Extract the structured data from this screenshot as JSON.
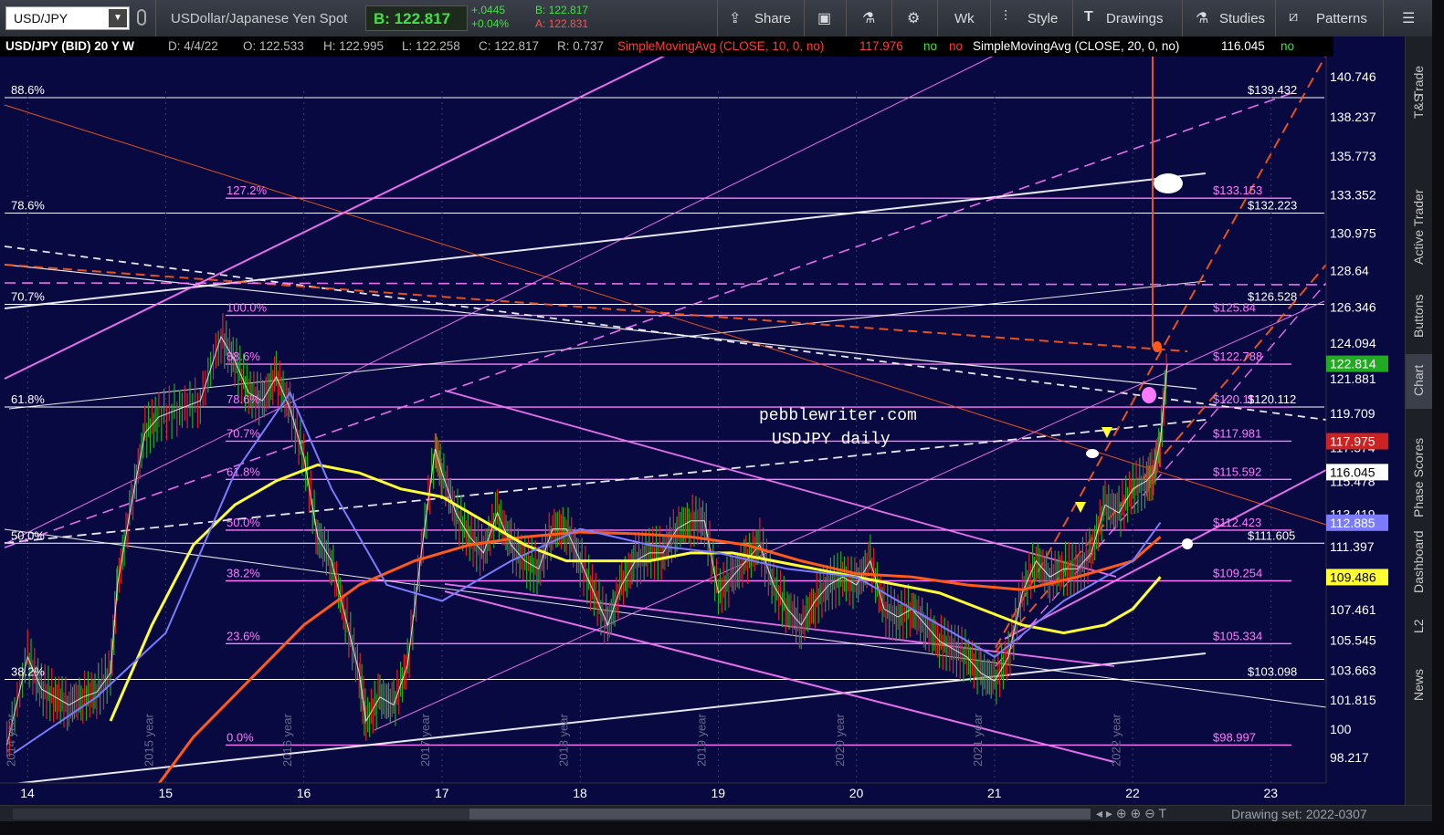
{
  "toolbar": {
    "symbol": "USD/JPY",
    "description": "USDollar/Japanese Yen Spot",
    "bid_price": "B: 122.817",
    "change": "+.0445",
    "change_pct": "+0.04%",
    "bid_small": "B: 122.817",
    "ask_small": "A: 122.831",
    "share": "Share",
    "period": "Wk",
    "style": "Style",
    "drawings": "Drawings",
    "studies": "Studies",
    "patterns": "Patterns"
  },
  "infobar": {
    "title": "USD/JPY (BID) 20 Y W",
    "date": "D: 4/4/22",
    "open": "O: 122.533",
    "high": "H: 122.995",
    "low": "L: 122.258",
    "close": "C: 122.817",
    "range": "R: 0.737",
    "sma10": "SimpleMovingAvg (CLOSE, 10, 0, no)",
    "sma10_val": "117.976",
    "sma10_no1": "no",
    "sma10_no2": "no",
    "sma20": "SimpleMovingAvg (CLOSE, 20, 0, no)",
    "sma20_val": "116.045",
    "sma20_no": "no"
  },
  "sidebar": {
    "tabs": [
      "Trade",
      "T&S",
      "Active Trader",
      "Buttons",
      "Chart",
      "Phase Scores",
      "Dashboard",
      "L2",
      "News"
    ]
  },
  "bottom": {
    "drawing_set": "Drawing set: 2022-0307"
  },
  "colors": {
    "background": "#090941",
    "fib_pink": "#ff7aff",
    "white": "#ffffff",
    "orange": "#ff5a1a",
    "yellow": "#ffff33",
    "blue": "#7b7bff",
    "green_candle": "#22aa22",
    "red_candle": "#dd2222"
  },
  "chart_data": {
    "type": "line",
    "title": "USD/JPY (BID) 20 Y W",
    "annotation": [
      "pebblewriter.com",
      "USDJPY daily"
    ],
    "x_ticks": [
      "14",
      "15",
      "16",
      "17",
      "18",
      "19",
      "20",
      "21",
      "22",
      "23"
    ],
    "year_labels": [
      "2014 year",
      "2015 year",
      "2016 year",
      "2017 year",
      "2018 year",
      "2019 year",
      "2020 year",
      "2021 year",
      "2022 year"
    ],
    "y_ticks": [
      140.746,
      138.237,
      135.773,
      133.352,
      130.975,
      128.64,
      126.346,
      124.094,
      121.881,
      119.709,
      117.574,
      115.478,
      113.419,
      111.397,
      109.411,
      107.461,
      105.545,
      103.663,
      101.815,
      100,
      98.217
    ],
    "ylim": [
      96.8,
      142.0
    ],
    "xlim": [
      2013.8,
      2023.4
    ],
    "last_price": 122.814,
    "price_flags": [
      {
        "label": "122.814",
        "value": 122.814,
        "color": "#22aa22"
      },
      {
        "label": "117.975",
        "value": 117.975,
        "color": "#cc2222"
      },
      {
        "label": "116.045",
        "value": 116.045,
        "color": "#ffffff"
      },
      {
        "label": "112.885",
        "value": 112.885,
        "color": "#7b7bff"
      },
      {
        "label": "109.486",
        "value": 109.486,
        "color": "#ffff33"
      }
    ],
    "right_levels": [
      {
        "label": "$139.432",
        "value": 139.432,
        "color": "#ffffff"
      },
      {
        "label": "$133.153",
        "value": 133.153,
        "color": "#ff7aff"
      },
      {
        "label": "$132.223",
        "value": 132.223,
        "color": "#ffffff"
      },
      {
        "label": "$126.528",
        "value": 126.528,
        "color": "#ffffff"
      },
      {
        "label": "$125.84",
        "value": 125.84,
        "color": "#ff7aff"
      },
      {
        "label": "$122.788",
        "value": 122.788,
        "color": "#ff7aff"
      },
      {
        "label": "$120.11",
        "value": 120.11,
        "color": "#ff7aff"
      },
      {
        "label": "$120.112",
        "value": 120.112,
        "color": "#ffffff"
      },
      {
        "label": "$117.981",
        "value": 117.981,
        "color": "#ff7aff"
      },
      {
        "label": "$115.592",
        "value": 115.592,
        "color": "#ff7aff"
      },
      {
        "label": "$112.423",
        "value": 112.423,
        "color": "#ff7aff"
      },
      {
        "label": "$111.605",
        "value": 111.605,
        "color": "#ffffff"
      },
      {
        "label": "$109.254",
        "value": 109.254,
        "color": "#ff7aff"
      },
      {
        "label": "$105.334",
        "value": 105.334,
        "color": "#ff7aff"
      },
      {
        "label": "$103.098",
        "value": 103.098,
        "color": "#ffffff"
      },
      {
        "label": "$98.997",
        "value": 98.997,
        "color": "#ff7aff"
      }
    ],
    "fib_left_white": [
      {
        "label": "88.6%",
        "value": 139.432
      },
      {
        "label": "78.6%",
        "value": 132.223
      },
      {
        "label": "70.7%",
        "value": 126.528
      },
      {
        "label": "61.8%",
        "value": 120.112
      },
      {
        "label": "50.0%",
        "value": 111.605
      },
      {
        "label": "38.2%",
        "value": 103.098
      }
    ],
    "fib_left_pink": [
      {
        "label": "127.2%",
        "value": 133.153
      },
      {
        "label": "100.0%",
        "value": 125.84
      },
      {
        "label": "88.6%",
        "value": 122.788
      },
      {
        "label": "78.6%",
        "value": 120.11
      },
      {
        "label": "70.7%",
        "value": 117.981
      },
      {
        "label": "61.8%",
        "value": 115.592
      },
      {
        "label": "50.0%",
        "value": 112.423
      },
      {
        "label": "38.2%",
        "value": 109.254
      },
      {
        "label": "23.6%",
        "value": 105.334
      },
      {
        "label": "0.0%",
        "value": 98.997
      }
    ],
    "series": [
      {
        "name": "USD/JPY",
        "color": "#ffffff",
        "x": [
          2013.85,
          2014.0,
          2014.1,
          2014.2,
          2014.3,
          2014.4,
          2014.5,
          2014.6,
          2014.65,
          2014.75,
          2014.85,
          2014.95,
          2015.1,
          2015.25,
          2015.4,
          2015.5,
          2015.6,
          2015.7,
          2015.8,
          2015.9,
          2016.0,
          2016.1,
          2016.2,
          2016.3,
          2016.4,
          2016.45,
          2016.55,
          2016.65,
          2016.75,
          2016.85,
          2016.95,
          2017.0,
          2017.1,
          2017.2,
          2017.3,
          2017.4,
          2017.5,
          2017.6,
          2017.7,
          2017.8,
          2017.9,
          2018.0,
          2018.1,
          2018.2,
          2018.3,
          2018.4,
          2018.5,
          2018.6,
          2018.7,
          2018.8,
          2018.9,
          2019.0,
          2019.1,
          2019.2,
          2019.3,
          2019.4,
          2019.5,
          2019.6,
          2019.7,
          2019.8,
          2019.9,
          2020.0,
          2020.1,
          2020.2,
          2020.3,
          2020.4,
          2020.5,
          2020.6,
          2020.7,
          2020.8,
          2020.9,
          2021.0,
          2021.1,
          2021.2,
          2021.3,
          2021.4,
          2021.5,
          2021.6,
          2021.7,
          2021.8,
          2021.9,
          2022.0,
          2022.1,
          2022.15,
          2022.2,
          2022.25
        ],
        "values": [
          99.0,
          104.5,
          102.5,
          102.0,
          101.5,
          102.0,
          102.3,
          103.5,
          109.0,
          114.0,
          118.5,
          119.5,
          120.0,
          120.5,
          124.5,
          123.0,
          121.0,
          120.5,
          122.0,
          120.0,
          117.0,
          112.0,
          110.5,
          107.0,
          103.5,
          100.5,
          102.0,
          101.5,
          104.0,
          111.0,
          117.5,
          116.0,
          113.5,
          112.0,
          111.0,
          113.5,
          111.5,
          110.5,
          110.0,
          112.5,
          112.5,
          110.5,
          108.5,
          106.5,
          109.0,
          110.5,
          111.0,
          111.0,
          112.5,
          113.0,
          113.0,
          108.5,
          109.5,
          110.5,
          111.5,
          109.0,
          107.5,
          106.5,
          108.0,
          109.0,
          109.5,
          109.0,
          110.5,
          107.5,
          107.0,
          107.5,
          106.5,
          105.5,
          105.0,
          104.5,
          103.5,
          103.0,
          104.5,
          108.5,
          110.5,
          109.5,
          110.0,
          110.0,
          111.0,
          114.0,
          113.5,
          115.0,
          115.5,
          116.0,
          118.0,
          122.8
        ]
      },
      {
        "name": "SimpleMovingAvg (CLOSE, 10, 0, no)",
        "color": "#ff5a1a",
        "x": [
          2014.9,
          2015.2,
          2015.6,
          2016.0,
          2016.4,
          2016.8,
          2017.2,
          2017.6,
          2018.0,
          2018.4,
          2018.8,
          2019.2,
          2019.6,
          2020.0,
          2020.4,
          2020.8,
          2021.2,
          2021.6,
          2022.0,
          2022.2
        ],
        "values": [
          96.0,
          99.5,
          103.0,
          106.5,
          109.0,
          110.5,
          111.5,
          112.0,
          112.3,
          112.2,
          112.0,
          111.5,
          110.5,
          109.7,
          109.5,
          109.0,
          108.7,
          109.5,
          110.5,
          112.0
        ]
      },
      {
        "name": "SimpleMovingAvg (CLOSE, 20, 0, no)",
        "color": "#ffff33",
        "x": [
          2014.6,
          2014.9,
          2015.2,
          2015.5,
          2015.8,
          2016.1,
          2016.4,
          2016.7,
          2017.0,
          2017.3,
          2017.6,
          2017.9,
          2018.2,
          2018.5,
          2018.8,
          2019.1,
          2019.4,
          2019.7,
          2020.0,
          2020.3,
          2020.6,
          2020.9,
          2021.2,
          2021.5,
          2021.8,
          2022.0,
          2022.2
        ],
        "values": [
          100.5,
          106.5,
          111.5,
          114.0,
          115.5,
          116.5,
          116.0,
          115.0,
          114.5,
          113.0,
          111.5,
          110.5,
          110.5,
          110.5,
          111.0,
          111.0,
          110.5,
          110.0,
          109.5,
          109.0,
          108.5,
          107.5,
          106.5,
          106.0,
          106.5,
          107.5,
          109.5
        ]
      }
    ]
  }
}
